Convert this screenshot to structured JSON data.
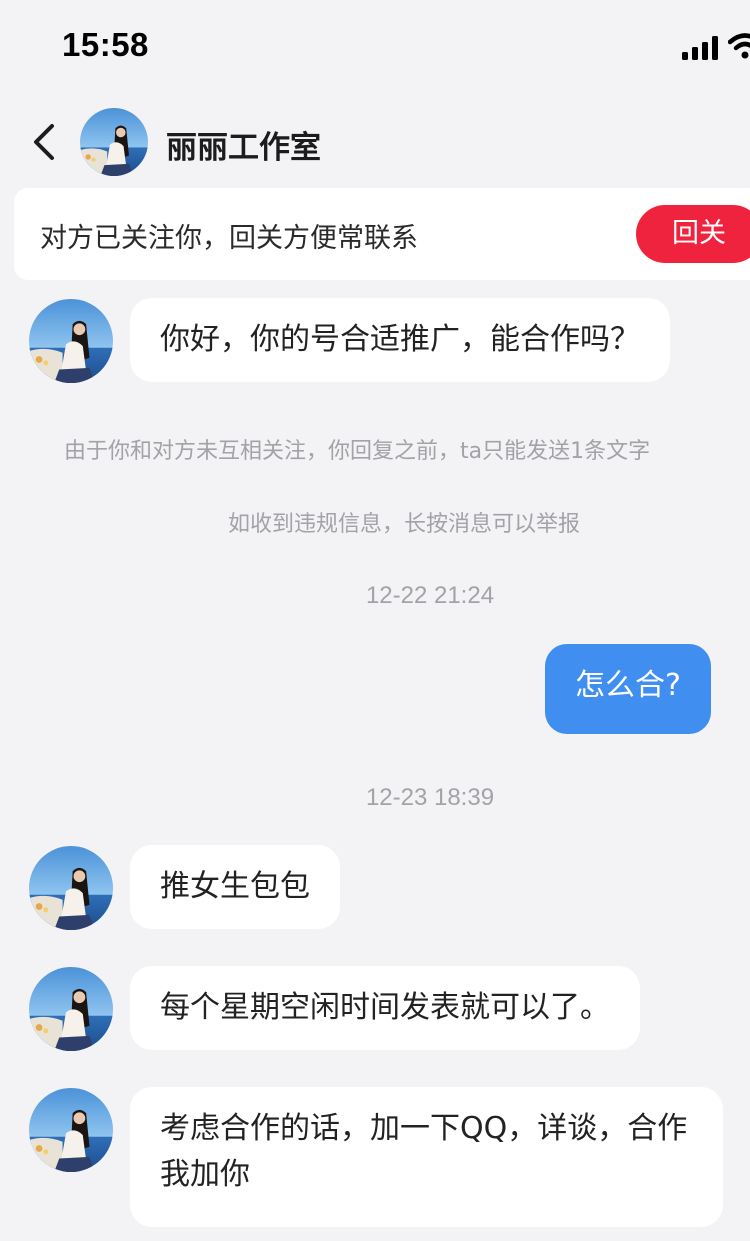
{
  "status_bar": {
    "time": "15:58",
    "signal_icon": "cellular-signal-icon",
    "wifi_icon": "wifi-icon"
  },
  "header": {
    "back_icon": "chevron-left-icon",
    "title": "丽丽工作室"
  },
  "follow_banner": {
    "text": "对方已关注你，回关方便常联系",
    "button_label": "回关",
    "button_color": "#f0233f"
  },
  "messages": [
    {
      "direction": "incoming",
      "text": "你好，你的号合适推广，能合作吗？"
    },
    {
      "direction": "system",
      "text": "由于你和对方未互相关注，你回复之前，ta只能发送1条文字"
    },
    {
      "direction": "system",
      "text": "如收到违规信息，长按消息可以举报"
    },
    {
      "direction": "timestamp",
      "text": "12-22 21:24"
    },
    {
      "direction": "outgoing",
      "text": "怎么合?"
    },
    {
      "direction": "timestamp",
      "text": "12-23 18:39"
    },
    {
      "direction": "incoming",
      "text": "推女生包包"
    },
    {
      "direction": "incoming",
      "text": "每个星期空闲时间发表就可以了。"
    },
    {
      "direction": "incoming",
      "text": "考虑合作的话，加一下QQ，详谈，合作我加你"
    }
  ],
  "colors": {
    "background": "#f3f3f5",
    "outgoing_bubble": "#3f8ef0",
    "incoming_bubble": "#ffffff",
    "accent": "#f0233f"
  }
}
